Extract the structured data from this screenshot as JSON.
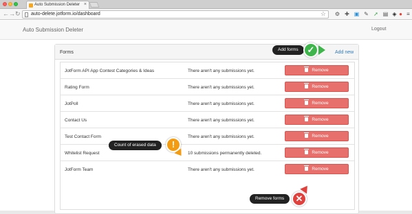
{
  "browser": {
    "tab_title": "Auto Submission Deleter",
    "url": "auto-delete.jotform.io/dashboard",
    "extensions": [
      "settings-icon",
      "puzzle-icon",
      "screen-icon",
      "pen-icon",
      "arrow-icon",
      "save-icon",
      "layers-icon",
      "shield-icon",
      "menu-icon"
    ]
  },
  "app": {
    "brand": "Auto Submission Deleter",
    "logout": "Logout"
  },
  "panel": {
    "title": "Forms",
    "add_new": "Add new",
    "rows": [
      {
        "name": "JotForm API App Contest Categories & Ideas",
        "status": "There aren't any submissions yet.",
        "action": "Remove"
      },
      {
        "name": "Rating Form",
        "status": "There aren't any submissions yet.",
        "action": "Remove"
      },
      {
        "name": "JotPoll",
        "status": "There aren't any submissions yet.",
        "action": "Remove"
      },
      {
        "name": "Contact Us",
        "status": "There aren't any submissions yet.",
        "action": "Remove"
      },
      {
        "name": "Test Contact Form",
        "status": "There aren't any submissions yet.",
        "action": "Remove"
      },
      {
        "name": "Whitelist Request",
        "status": "10 submissions permanently deleted.",
        "action": "Remove"
      },
      {
        "name": "JotForm Team",
        "status": "There aren't any submissions yet.",
        "action": "Remove"
      }
    ]
  },
  "callouts": {
    "add_forms": "Add forms",
    "count_erased": "Count of erased data",
    "remove_forms": "Remove forms"
  },
  "colors": {
    "remove_button": "#e8706c",
    "link": "#337ab7",
    "badge_green": "#3db54a",
    "badge_orange": "#f39c12",
    "badge_red": "#e0413c"
  }
}
